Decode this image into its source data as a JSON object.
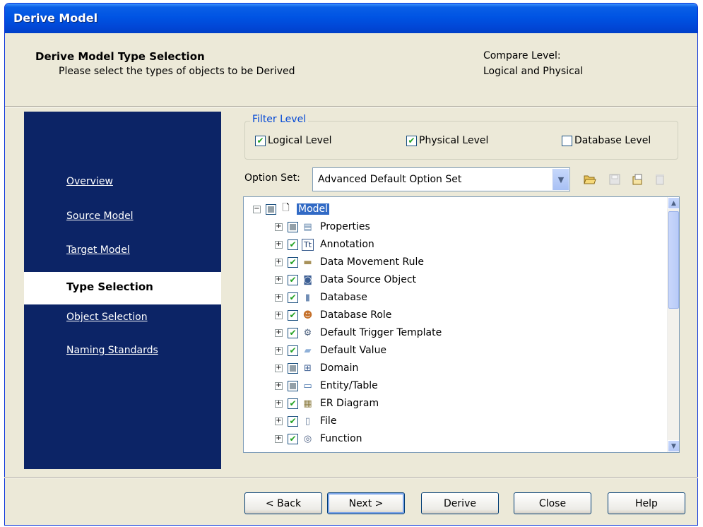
{
  "window": {
    "title": "Derive Model"
  },
  "header": {
    "title": "Derive Model Type Selection",
    "subtitle": "Please select the types of objects to be Derived",
    "compare_label": "Compare Level:",
    "compare_value": "Logical and Physical"
  },
  "nav": {
    "items": [
      "Overview",
      "Source Model",
      "Target Model",
      "Type Selection",
      "Object Selection",
      "Naming Standards"
    ],
    "active": "Type Selection"
  },
  "filter": {
    "legend": "Filter Level",
    "options": [
      {
        "label": "Logical Level",
        "checked": true
      },
      {
        "label": "Physical Level",
        "checked": true
      },
      {
        "label": "Database Level",
        "checked": false
      }
    ]
  },
  "option_set": {
    "label": "Option Set:",
    "value": "Advanced Default Option Set",
    "toolbar_icons": [
      "open-folder-icon",
      "save-icon",
      "new-icon",
      "delete-icon"
    ]
  },
  "tree": {
    "root": {
      "label": "Model",
      "state": "partial",
      "icon": "document-icon"
    },
    "items": [
      {
        "label": "Properties",
        "state": "partial",
        "icon": "properties-icon"
      },
      {
        "label": "Annotation",
        "state": "checked",
        "icon": "annotation-icon"
      },
      {
        "label": "Data Movement Rule",
        "state": "checked",
        "icon": "data-movement-rule-icon"
      },
      {
        "label": "Data Source Object",
        "state": "checked",
        "icon": "data-source-object-icon"
      },
      {
        "label": "Database",
        "state": "checked",
        "icon": "database-icon"
      },
      {
        "label": "Database Role",
        "state": "checked",
        "icon": "database-role-icon"
      },
      {
        "label": "Default Trigger Template",
        "state": "checked",
        "icon": "trigger-template-icon"
      },
      {
        "label": "Default Value",
        "state": "checked",
        "icon": "default-value-icon"
      },
      {
        "label": "Domain",
        "state": "partial",
        "icon": "domain-icon"
      },
      {
        "label": "Entity/Table",
        "state": "partial",
        "icon": "entity-table-icon"
      },
      {
        "label": "ER Diagram",
        "state": "checked",
        "icon": "er-diagram-icon"
      },
      {
        "label": "File",
        "state": "checked",
        "icon": "file-icon"
      },
      {
        "label": "Function",
        "state": "checked",
        "icon": "function-icon"
      }
    ]
  },
  "buttons": {
    "back": "< Back",
    "next": "Next >",
    "derive": "Derive",
    "close": "Close",
    "help": "Help"
  }
}
